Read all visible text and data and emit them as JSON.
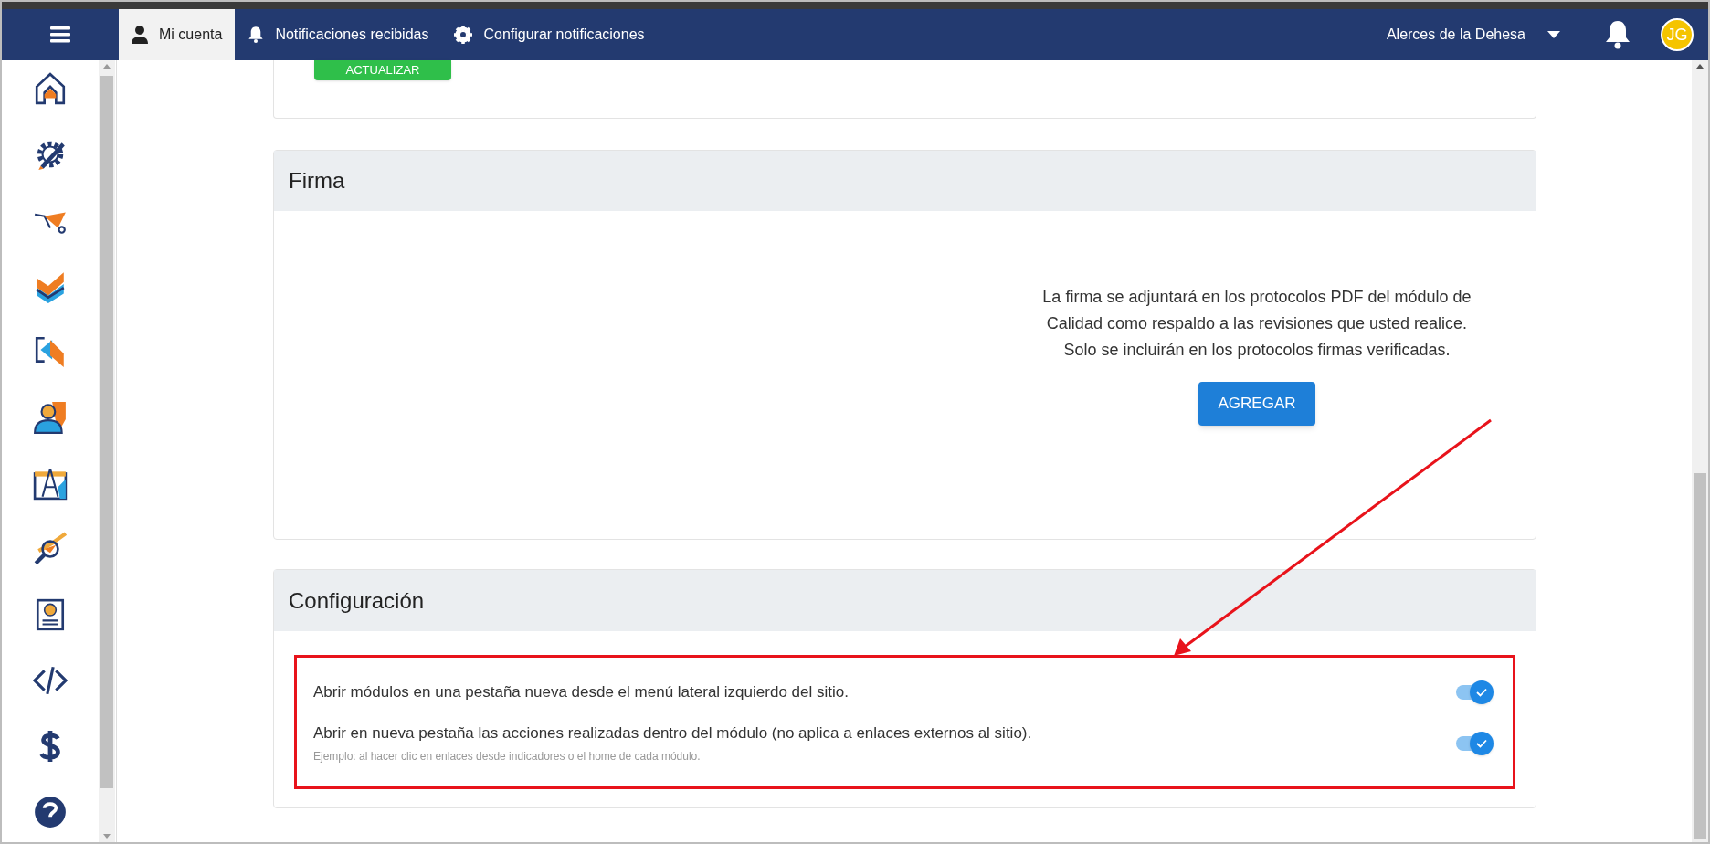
{
  "topbar": {
    "tabs": [
      {
        "label": "Mi cuenta",
        "selected": true
      },
      {
        "label": "Notificaciones recibidas",
        "selected": false
      },
      {
        "label": "Configurar notificaciones",
        "selected": false
      }
    ],
    "site_selector": "Alerces de la Dehesa",
    "avatar": "JG"
  },
  "profile_card": {
    "button": "ACTUALIZAR"
  },
  "signature_card": {
    "title": "Firma",
    "description": "La firma se adjuntará en los protocolos PDF del módulo de Calidad como respaldo a las revisiones que usted realice. Solo se incluirán en los protocolos firmas verificadas.",
    "button": "AGREGAR"
  },
  "settings_card": {
    "title": "Configuración",
    "options": [
      {
        "label": "Abrir módulos en una pestaña nueva desde el menú lateral izquierdo del sitio.",
        "on": true
      },
      {
        "label": "Abrir en nueva pestaña las acciones realizadas dentro del módulo (no aplica a enlaces externos al sitio).",
        "hint": "Ejemplo: al hacer clic en enlaces desde indicadores o el home de cada módulo.",
        "on": true
      }
    ]
  }
}
